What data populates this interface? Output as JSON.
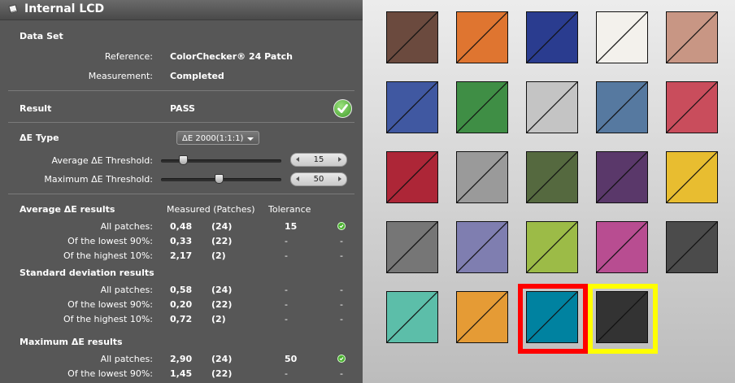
{
  "panel": {
    "title": "Internal LCD",
    "dataset": {
      "heading": "Data Set",
      "reference_label": "Reference:",
      "reference_value": "ColorChecker® 24 Patch",
      "measurement_label": "Measurement:",
      "measurement_value": "Completed"
    },
    "result": {
      "label": "Result",
      "value": "PASS"
    },
    "de_type": {
      "label": "ΔE Type",
      "selected": "ΔE 2000(1:1:1)",
      "average_label": "Average  ΔE Threshold:",
      "average_value": "15",
      "maximum_label": "Maximum ΔE Threshold:",
      "maximum_value": "50"
    },
    "results": {
      "avg_heading": "Average ΔE results",
      "col_measured": "Measured (Patches)",
      "col_tolerance": "Tolerance",
      "avg_rows": [
        {
          "label": "All patches:",
          "measured": "0,48",
          "patches": "(24)",
          "tolerance": "15",
          "status": "check"
        },
        {
          "label": "Of the lowest 90%:",
          "measured": "0,33",
          "patches": "(22)",
          "tolerance": "-",
          "status": "-"
        },
        {
          "label": "Of the highest 10%:",
          "measured": "2,17",
          "patches": "(2)",
          "tolerance": "-",
          "status": "-"
        }
      ],
      "std_heading": "Standard deviation results",
      "std_rows": [
        {
          "label": "All patches:",
          "measured": "0,58",
          "patches": "(24)",
          "tolerance": "-",
          "status": "-"
        },
        {
          "label": "Of the lowest 90%:",
          "measured": "0,20",
          "patches": "(22)",
          "tolerance": "-",
          "status": "-"
        },
        {
          "label": "Of the highest 10%:",
          "measured": "0,72",
          "patches": "(2)",
          "tolerance": "-",
          "status": "-"
        }
      ],
      "max_heading": "Maximum ΔE results",
      "max_rows": [
        {
          "label": "All patches:",
          "measured": "2,90",
          "patches": "(24)",
          "tolerance": "50",
          "status": "check"
        },
        {
          "label": "Of the lowest 90%:",
          "measured": "1,45",
          "patches": "(22)",
          "tolerance": "-",
          "status": "-"
        }
      ]
    }
  },
  "patches": [
    "#6b4a3e",
    "#df7530",
    "#2a3c8f",
    "#f3f1ec",
    "#c89684",
    "#4058a1",
    "#3f8e45",
    "#c4c4c4",
    "#5679a0",
    "#c94d5c",
    "#ad2637",
    "#9a9a9a",
    "#55693f",
    "#5a386a",
    "#e8bd30",
    "#767676",
    "#7f7eb0",
    "#9cbb47",
    "#b84d91",
    "#4b4b4b",
    "#5cbea9",
    "#e59b35",
    "#0082a0",
    "#333333"
  ],
  "highlights": {
    "red": "#ff0000",
    "yellow": "#ffff00"
  }
}
